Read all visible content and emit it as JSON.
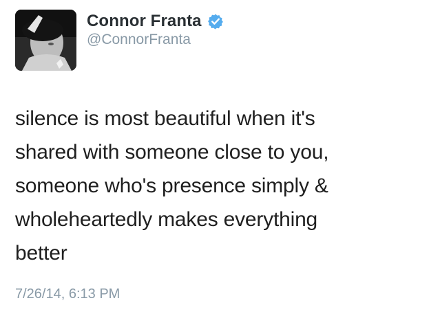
{
  "user": {
    "display_name": "Connor Franta",
    "handle": "@ConnorFranta",
    "verified_icon": "verified-badge-icon",
    "avatar_icon": "profile-photo"
  },
  "tweet": {
    "text": "silence is most beautiful when it's\nshared with someone close to you,\nsomeone who's presence simply &\nwholeheartedly makes everything\nbetter",
    "timestamp": "7/26/14, 6:13 PM"
  },
  "colors": {
    "verified_blue": "#55acee",
    "secondary_text": "#8899a6",
    "primary_text": "#292f33"
  }
}
